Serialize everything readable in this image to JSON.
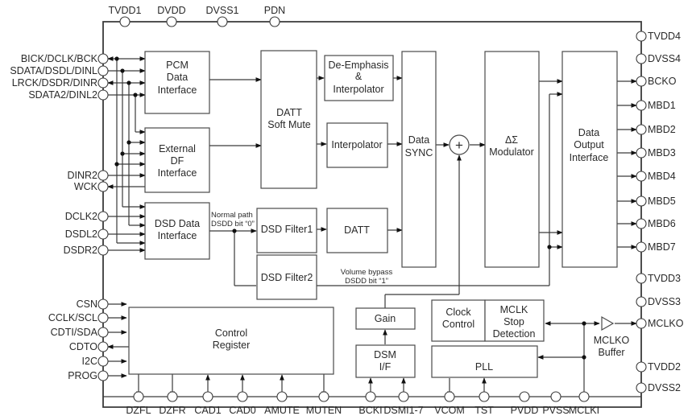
{
  "diagram": {
    "type": "block-diagram",
    "pins": {
      "top": [
        "TVDD1",
        "DVDD",
        "DVSS1",
        "PDN"
      ],
      "left": [
        "BICK/DCLK/BCK",
        "SDATA/DSDL/DINL",
        "LRCK/DSDR/DINR",
        "SDATA2/DINL2",
        "DINR2",
        "WCK",
        "DCLK2",
        "DSDL2",
        "DSDR2",
        "CSN",
        "CCLK/SCL",
        "CDTI/SDA",
        "CDTO",
        "I2C",
        "PROG"
      ],
      "right": [
        "TVDD4",
        "DVSS4",
        "BCKO",
        "MBD1",
        "MBD2",
        "MBD3",
        "MBD4",
        "MBD5",
        "MBD6",
        "MBD7",
        "TVDD3",
        "DVSS3",
        "MCLKO",
        "TVDD2",
        "DVSS2"
      ],
      "bottom": [
        "DZFL",
        "DZFR",
        "CAD1",
        "CAD0",
        "AMUTE",
        "MUTEN",
        "BCKI",
        "DSMI1-7",
        "VCOM",
        "TST",
        "PVDD",
        "PVSS",
        "MCLKI"
      ]
    },
    "blocks": {
      "pcm": [
        "PCM",
        "Data",
        "Interface"
      ],
      "extdf": [
        "External",
        "DF",
        "Interface"
      ],
      "dsd_if": [
        "DSD Data",
        "Interface"
      ],
      "datt_softmute": [
        "DATT",
        "Soft Mute"
      ],
      "deemph": [
        "De-Emphasis",
        "&",
        "Interpolator"
      ],
      "interp": [
        "Interpolator"
      ],
      "dsd_filter1": [
        "DSD Filter1"
      ],
      "dsd_filter2": [
        "DSD Filter2"
      ],
      "datt": [
        "DATT"
      ],
      "data_sync": [
        "Data",
        "SYNC"
      ],
      "modulator": [
        "ΔΣ",
        "Modulator"
      ],
      "data_out": [
        "Data",
        "Output",
        "Interface"
      ],
      "control_reg": [
        "Control",
        "Register"
      ],
      "gain": [
        "Gain"
      ],
      "dsm_if": [
        "DSM",
        "I/F"
      ],
      "clock_control": [
        "Clock",
        "Control"
      ],
      "mclk_stop": [
        "MCLK",
        "Stop",
        "Detection"
      ],
      "pll": [
        "PLL"
      ],
      "mclko_buffer": [
        "MCLKO",
        "Buffer"
      ],
      "summer": "+"
    },
    "annotations": {
      "normal_path": [
        "Normal path",
        "DSDD bit “0”"
      ],
      "volume_bypass": [
        "Volume bypass",
        "DSDD bit “1”"
      ]
    }
  }
}
